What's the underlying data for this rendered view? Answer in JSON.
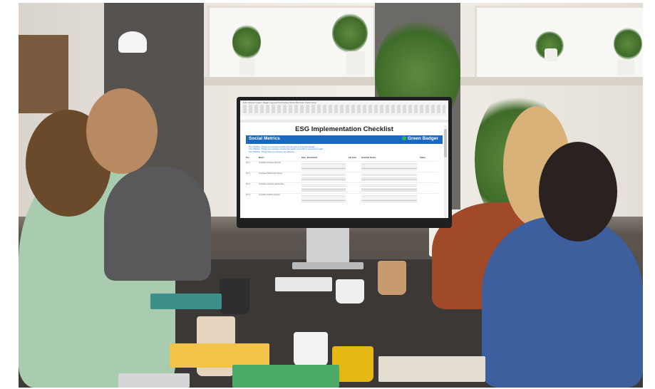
{
  "scene": {
    "description_alt": "",
    "colors": {
      "screen_band": "#1a69c1",
      "brand_icon": "#2fb34a",
      "table": "#3b3836",
      "wall": "#ece8e1"
    }
  },
  "spreadsheet": {
    "ribbon_tabs": "File  Home  Insert  Page Layout  Formulas  Data  Review  View  Help",
    "title": "ESG Implementation Checklist",
    "section": "Social Metrics",
    "brand": "Green Badger",
    "tiers": [
      "Tier 1 Metrics - Things your company controls that are easy to track and manage",
      "Tier 2 Metrics - Things your company controls that require more effort or resources to track",
      "Tier 3 Metrics - Things that your company can influence"
    ],
    "columns": [
      "Tier",
      "Metric",
      "Data - Benchmark",
      "Set Goal",
      "Potential Tactics",
      "Status"
    ],
    "rows": [
      {
        "tier": "Tier 1",
        "metric": "Corporate employee diversity"
      },
      {
        "tier": "Tier 1",
        "metric": "Corporate Philanthropic Spend"
      },
      {
        "tier": "Tier 1",
        "metric": "Corporate volunteer opportunities"
      },
      {
        "tier": "Tier 2",
        "metric": "Corporate wellness program"
      }
    ]
  }
}
